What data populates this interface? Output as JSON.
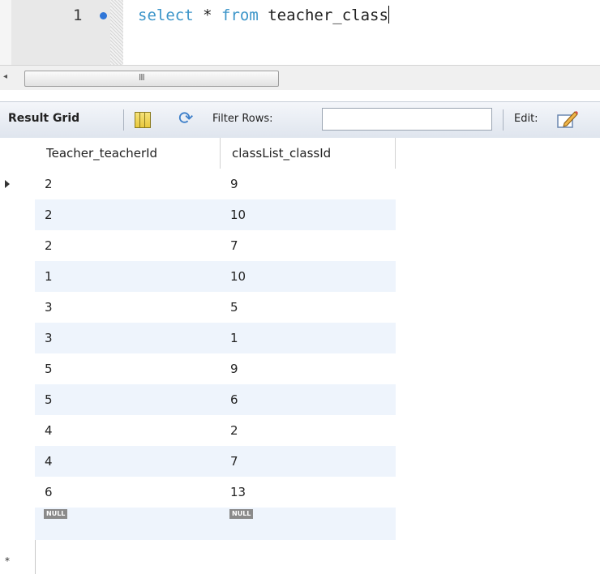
{
  "editor": {
    "line_number": "1",
    "code_keyword_1": "select",
    "code_symbol": "*",
    "code_keyword_2": "from",
    "code_identifier": "teacher_class",
    "scroll_grip": "III"
  },
  "toolbar": {
    "result_grid_label": "Result Grid",
    "filter_rows_label": "Filter Rows:",
    "filter_value": "",
    "edit_label": "Edit:"
  },
  "icons": {
    "gutter_dot": "breakpoint-dot-icon",
    "grid": "form-grid-icon",
    "refresh": "refresh-arrows-icon",
    "edit": "pencil-edit-icon",
    "current_row": "row-pointer-icon",
    "new_row": "asterisk-icon"
  },
  "colors": {
    "keyword": "#3c95c9",
    "alt_row": "#eef4fc",
    "null_badge": "#8a8a8a"
  },
  "grid": {
    "columns": [
      "Teacher_teacherId",
      "classList_classId"
    ],
    "rows": [
      [
        "2",
        "9"
      ],
      [
        "2",
        "10"
      ],
      [
        "2",
        "7"
      ],
      [
        "1",
        "10"
      ],
      [
        "3",
        "5"
      ],
      [
        "3",
        "1"
      ],
      [
        "5",
        "9"
      ],
      [
        "5",
        "6"
      ],
      [
        "4",
        "2"
      ],
      [
        "4",
        "7"
      ],
      [
        "6",
        "13"
      ]
    ],
    "null_label": "NULL",
    "new_row_marker": "*"
  }
}
